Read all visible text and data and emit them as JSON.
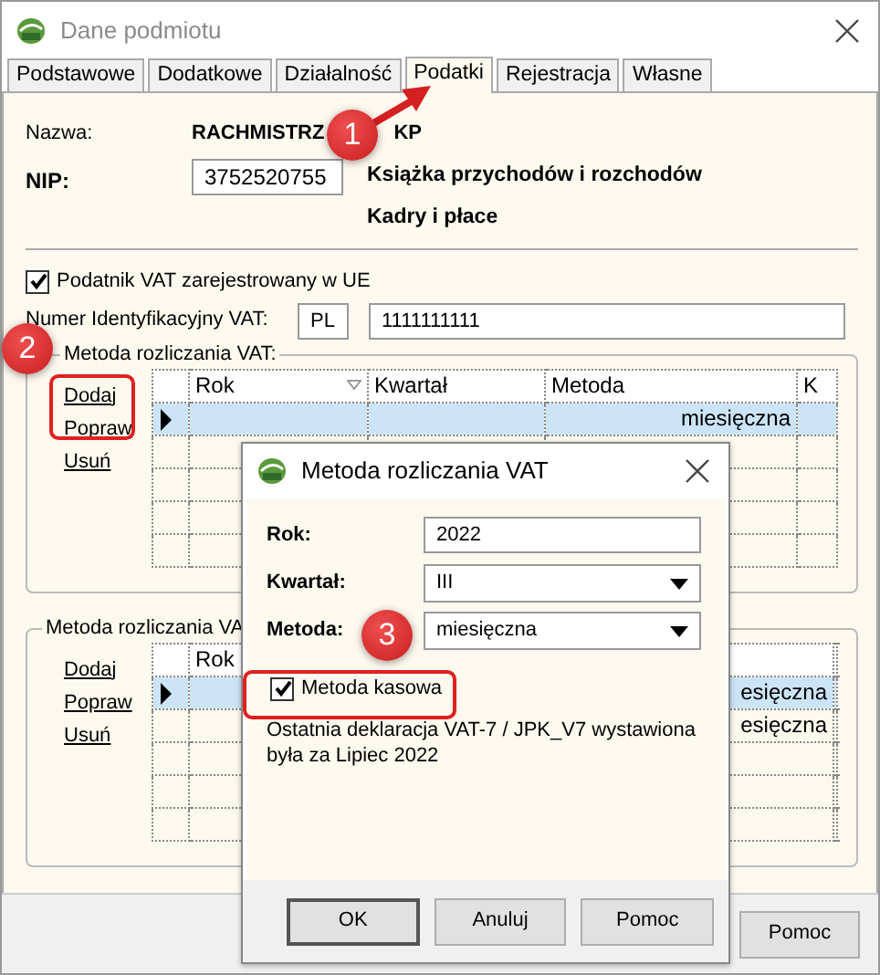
{
  "window": {
    "title": "Dane podmiotu"
  },
  "tabs": [
    {
      "label": "Podstawowe",
      "selected": false
    },
    {
      "label": "Dodatkowe",
      "selected": false
    },
    {
      "label": "Działalność",
      "selected": false
    },
    {
      "label": "Podatki",
      "selected": true
    },
    {
      "label": "Rejestracja",
      "selected": false
    },
    {
      "label": "Własne",
      "selected": false
    }
  ],
  "name": {
    "label": "Nazwa:",
    "value_parts": [
      "RACHMISTRZ",
      "KP"
    ]
  },
  "nip": {
    "label": "NIP:",
    "value": "3752520755"
  },
  "modules": [
    "Książka przychodów i rozchodów",
    "Kadry i płace"
  ],
  "eu_vat": {
    "label": "Podatnik VAT zarejestrowany w UE",
    "checked": true
  },
  "vat_id": {
    "label": "Numer Identyfikacyjny VAT:",
    "prefix": "PL",
    "value": "1111111111"
  },
  "groups": [
    {
      "legend": "Metoda rozliczania VAT:",
      "sort_marker": true,
      "links": [
        "Dodaj",
        "Popraw",
        "Usuń"
      ],
      "columns": [
        "Rok",
        "Kwartał",
        "Metoda",
        "K"
      ],
      "rows": [
        {
          "metoda": "miesięczna",
          "selected": true,
          "current": true
        },
        {
          "selected": false,
          "current": false
        },
        {
          "selected": false,
          "current": false
        },
        {
          "selected": false,
          "current": false
        },
        {
          "selected": false,
          "current": false
        }
      ]
    },
    {
      "legend": "Metoda rozliczania VA",
      "links": [
        "Dodaj",
        "Popraw",
        "Usuń"
      ],
      "columns": [
        "Rok"
      ],
      "rows": [
        {
          "metoda": "esięczna",
          "selected": true,
          "current": true
        },
        {
          "metoda": "esięczna",
          "selected": false,
          "current": false
        },
        {
          "selected": false,
          "current": false
        },
        {
          "selected": false,
          "current": false
        },
        {
          "selected": false,
          "current": false
        }
      ]
    }
  ],
  "footer_buttons": [
    "Pomoc"
  ],
  "dialog": {
    "title": "Metoda rozliczania VAT",
    "fields": [
      {
        "kind": "text",
        "label": "Rok:",
        "value": "2022"
      },
      {
        "kind": "select",
        "label": "Kwartał:",
        "value": "III"
      },
      {
        "kind": "select",
        "label": "Metoda:",
        "value": "miesięczna"
      }
    ],
    "cash_method": {
      "label": "Metoda kasowa",
      "checked": true
    },
    "note": "Ostatnia deklaracja VAT-7 / JPK_V7 wystawiona była za Lipiec 2022",
    "buttons": [
      {
        "label": "OK",
        "default": true
      },
      {
        "label": "Anuluj",
        "default": false
      },
      {
        "label": "Pomoc",
        "default": false
      }
    ]
  },
  "annotations": [
    {
      "number": "1"
    },
    {
      "number": "2"
    },
    {
      "number": "3"
    }
  ]
}
